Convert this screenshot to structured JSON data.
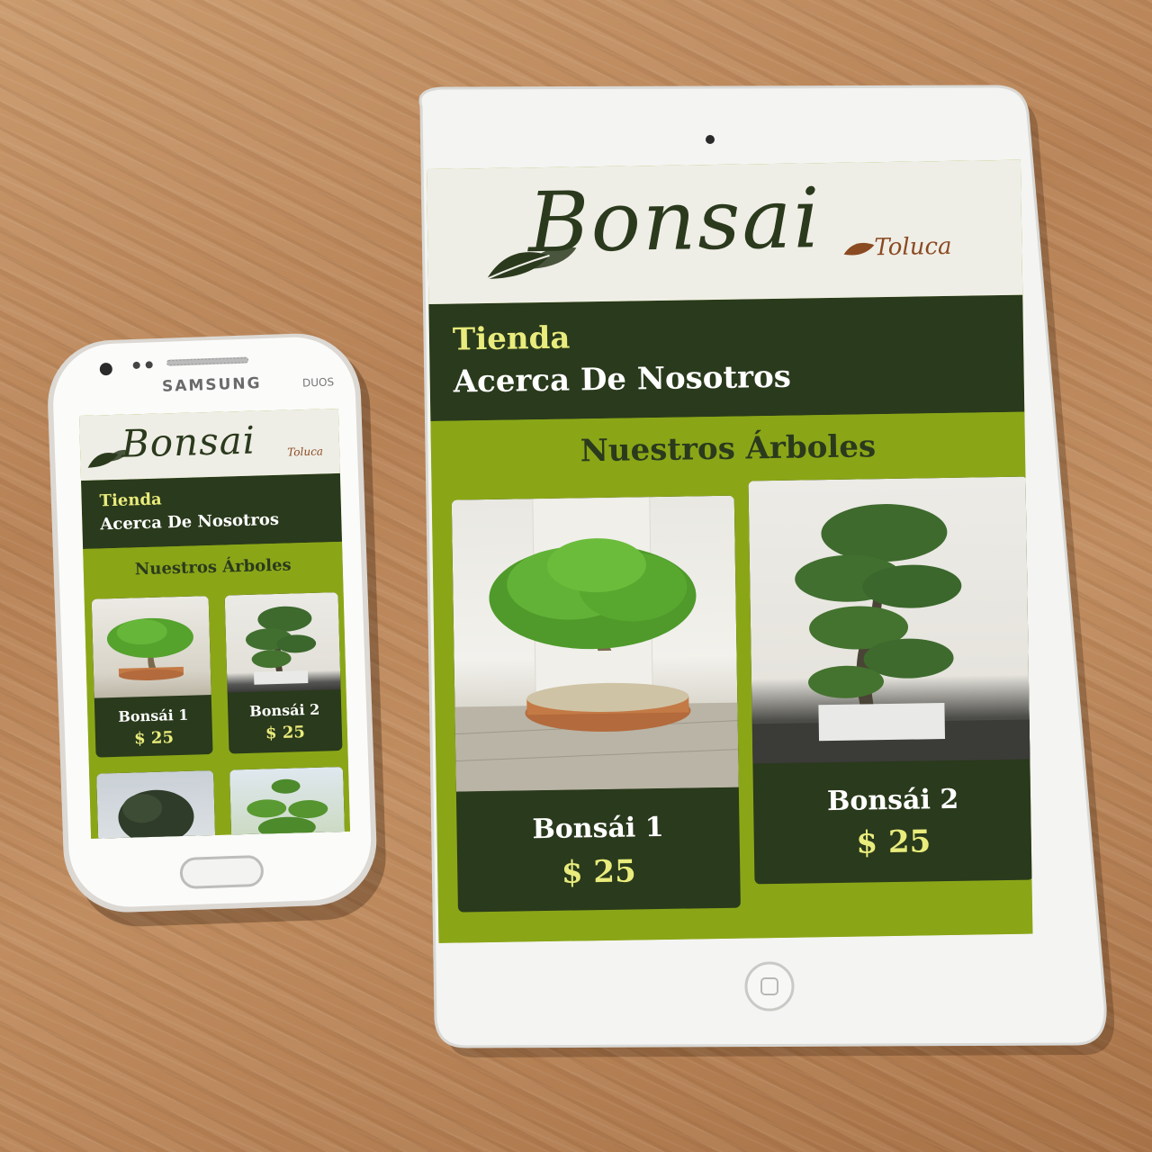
{
  "phone": {
    "brand": "SAMSUNG",
    "model": "DUOS"
  },
  "site": {
    "logo_main": "Bonsai",
    "logo_sub": "Toluca",
    "nav": [
      {
        "label": "Tienda",
        "active": true
      },
      {
        "label": "Acerca De Nosotros",
        "active": false
      }
    ],
    "section_title": "Nuestros Árboles",
    "products": [
      {
        "name": "Bonsái 1",
        "price": "$ 25"
      },
      {
        "name": "Bonsái 2",
        "price": "$ 25"
      }
    ]
  },
  "colors": {
    "header_bg": "#efeee6",
    "nav_bg": "#2a3a1c",
    "content_bg": "#8aa617",
    "active_nav": "#e9ec7c",
    "price": "#e9ec7c",
    "logo": "#2b3a1d",
    "logo_sub": "#8a4a22"
  }
}
